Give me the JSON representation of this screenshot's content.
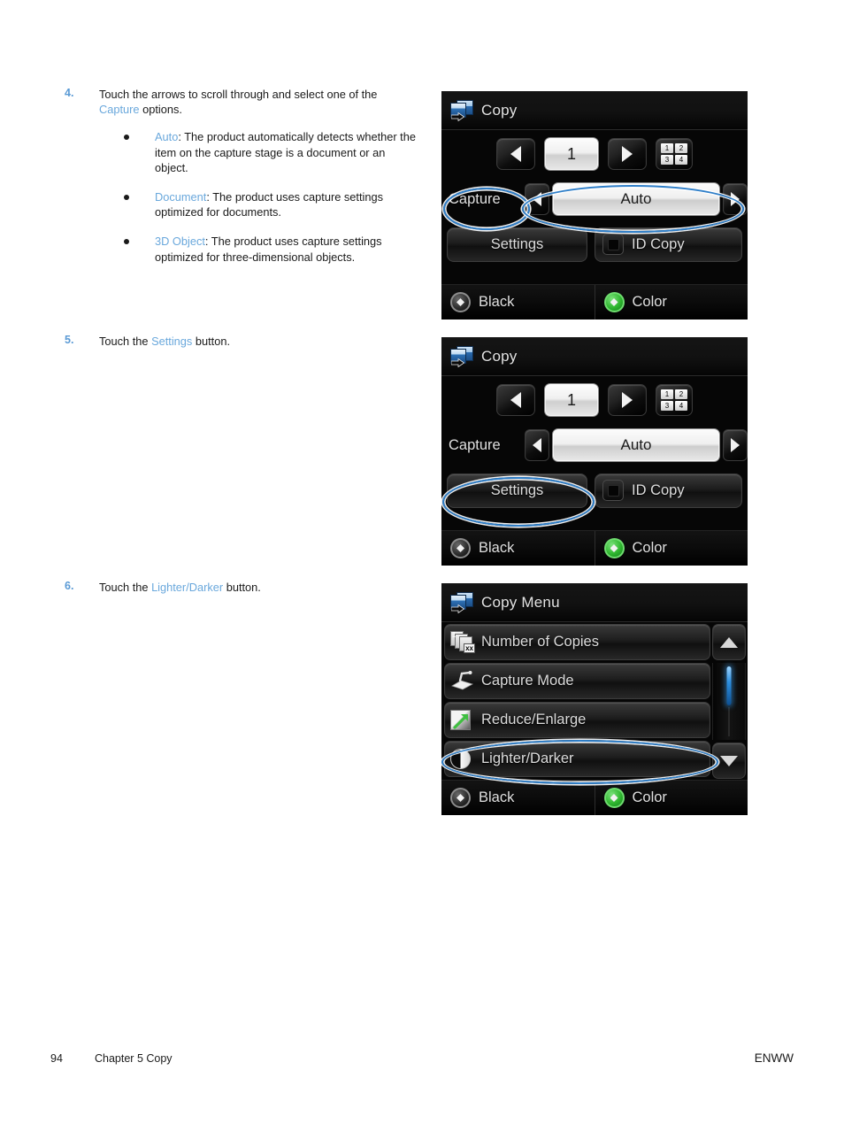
{
  "document": {
    "footer": {
      "page_number": "94",
      "chapter": "Chapter 5   Copy",
      "right": "ENWW"
    }
  },
  "steps": [
    {
      "number": "4.",
      "text_before": "Touch the arrows to scroll through and select one of the ",
      "accent": "Capture",
      "text_after": " options.",
      "sublist": [
        {
          "accent": "Auto",
          "text": ": The product automatically detects whether the item on the capture stage is a document or an object."
        },
        {
          "accent": "Document",
          "text": ": The product uses capture settings optimized for documents."
        },
        {
          "accent": "3D Object",
          "text": ": The product uses capture settings optimized for three-dimensional objects."
        }
      ]
    },
    {
      "number": "5.",
      "text_before": "Touch the ",
      "accent": "Settings",
      "text_after": " button."
    },
    {
      "number": "6.",
      "text_before": "Touch the ",
      "accent": "Lighter/Darker",
      "text_after": " button."
    }
  ],
  "panels": {
    "panel1": {
      "header_title": "Copy",
      "copy_count": "1",
      "capture_label": "Capture",
      "capture_value": "Auto",
      "settings_label": "Settings",
      "id_copy_label": "ID Copy",
      "black_label": "Black",
      "color_label": "Color",
      "highlights": [
        "Capture",
        "Auto"
      ]
    },
    "panel2": {
      "header_title": "Copy",
      "copy_count": "1",
      "capture_label": "Capture",
      "capture_value": "Auto",
      "settings_label": "Settings",
      "id_copy_label": "ID Copy",
      "black_label": "Black",
      "color_label": "Color",
      "highlights": [
        "Settings"
      ]
    },
    "panel3": {
      "header_title": "Copy Menu",
      "menu_items": [
        {
          "label": "Number of Copies",
          "icon": "copies-icon"
        },
        {
          "label": "Capture Mode",
          "icon": "capture-stage-icon"
        },
        {
          "label": "Reduce/Enlarge",
          "icon": "resize-arrow-icon"
        },
        {
          "label": "Lighter/Darker",
          "icon": "contrast-icon"
        }
      ],
      "black_label": "Black",
      "color_label": "Color",
      "highlights": [
        "Lighter/Darker"
      ]
    }
  },
  "keypad_icon_keys": [
    "1",
    "2",
    "3",
    "4"
  ],
  "colors": {
    "accent_blue": "#6aa8dc",
    "highlight_ring": "#2f7fc9",
    "color_button_green": "#2fb62f",
    "screen_background": "#060606"
  }
}
